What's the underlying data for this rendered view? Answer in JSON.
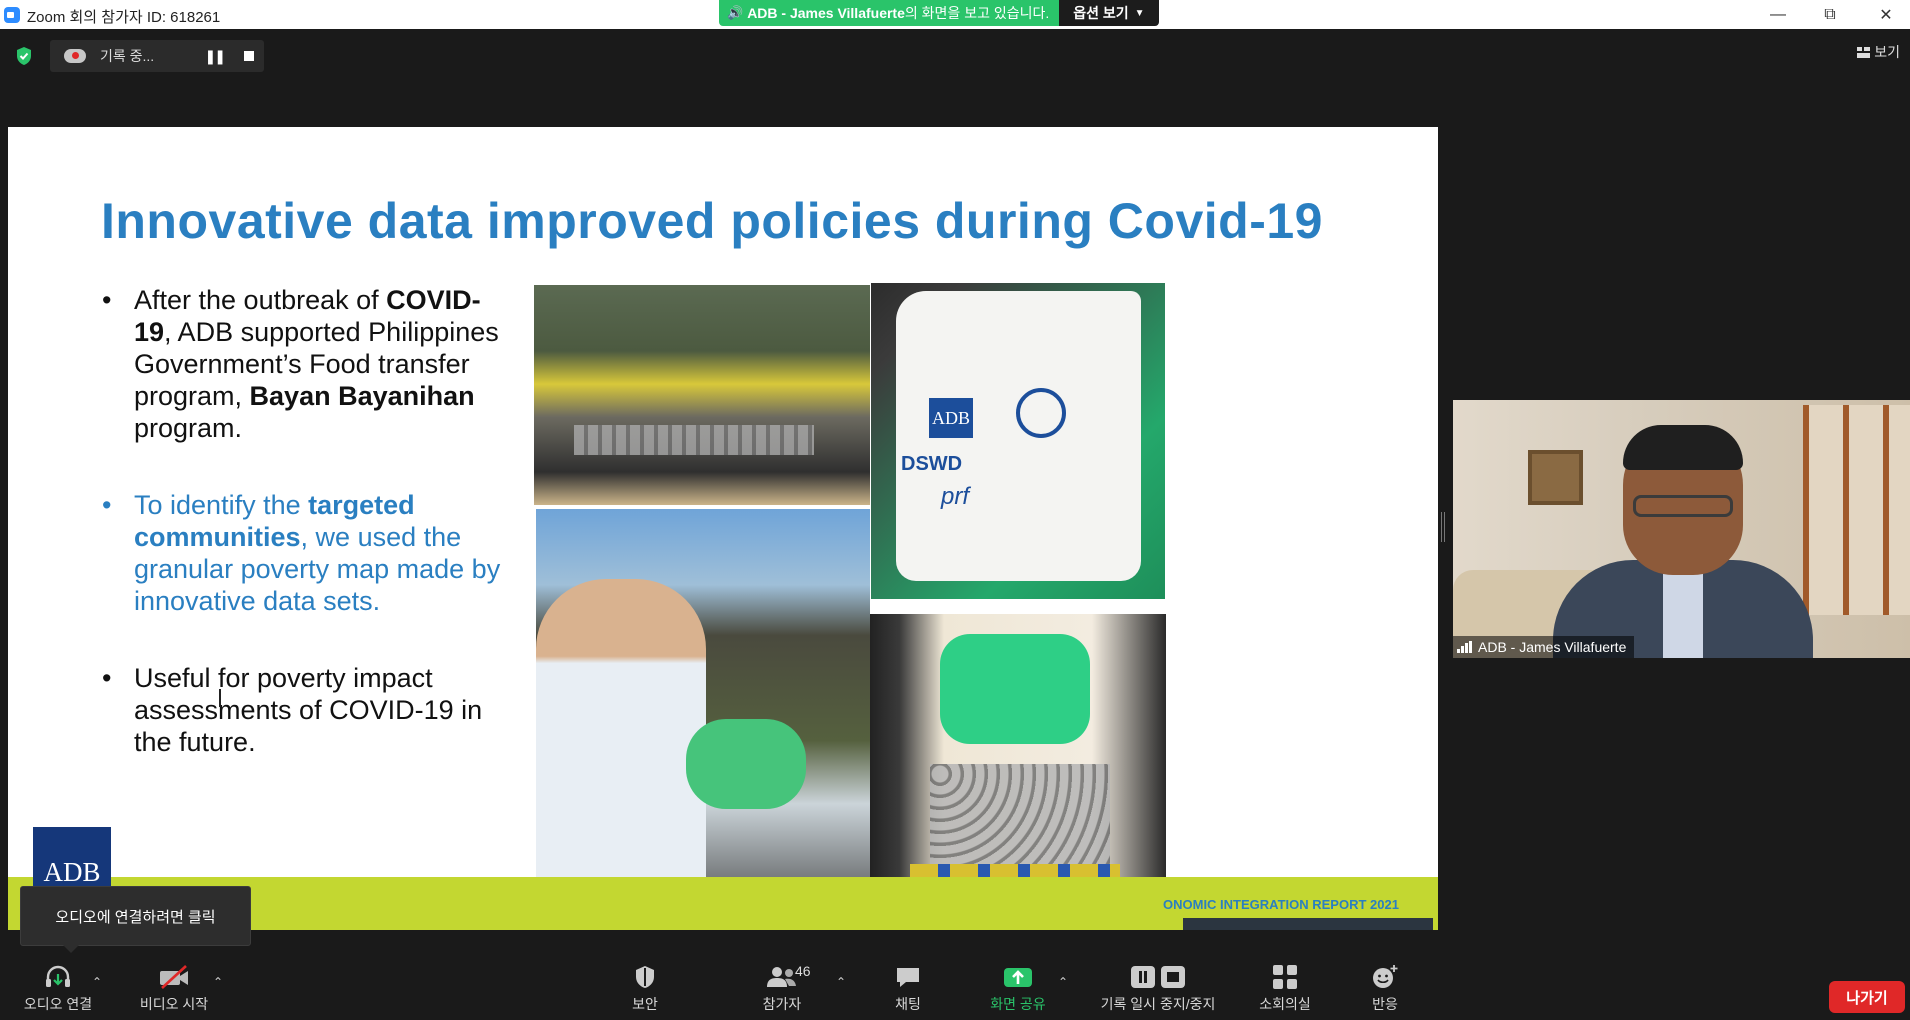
{
  "window": {
    "title": "Zoom 회의 참가자 ID: 618261"
  },
  "share_banner": {
    "presenter": "ADB - James Villafuerte",
    "suffix": "의 화면을 보고 있습니다.",
    "options_label": "옵션 보기"
  },
  "recording": {
    "status": "기록 중..."
  },
  "view_button": {
    "label": "보기"
  },
  "slide": {
    "title": "Innovative data improved policies during Covid-19",
    "bullet1_a": "After the outbreak of ",
    "bullet1_b": "COVID-19",
    "bullet1_c": ", ADB supported Philippines Government’s Food transfer program, ",
    "bullet1_d": "Bayan Bayanihan",
    "bullet1_e": " program.",
    "bullet2_a": "To identify the ",
    "bullet2_b": "targeted communities",
    "bullet2_c": ", we used the granular poverty map made by innovative data sets.",
    "bullet3": "Useful for poverty impact assessments of COVID-19 in the future.",
    "logo_text": "ADB",
    "footer_text": "ONOMIC INTEGRATION REPORT 2021",
    "photo_bag_adb": "ADB",
    "photo_bag_dswd": "DSWD",
    "photo_bag_prf": "prf"
  },
  "video": {
    "participant_name": "ADB - James Villafuerte"
  },
  "tooltip": {
    "text": "오디오에 연결하려면 클릭"
  },
  "toolbar": {
    "audio": "오디오 연결",
    "video": "비디오 시작",
    "security": "보안",
    "participants": "참가자",
    "participants_count": "46",
    "chat": "채팅",
    "share": "화면 공유",
    "record": "기록 일시 중지/중지",
    "breakout": "소회의실",
    "reactions": "반응",
    "leave": "나가기"
  },
  "colors": {
    "share_green": "#2ac46a",
    "leave_red": "#e02828",
    "slide_blue": "#2a7fc1",
    "band_green": "#c3d731"
  }
}
